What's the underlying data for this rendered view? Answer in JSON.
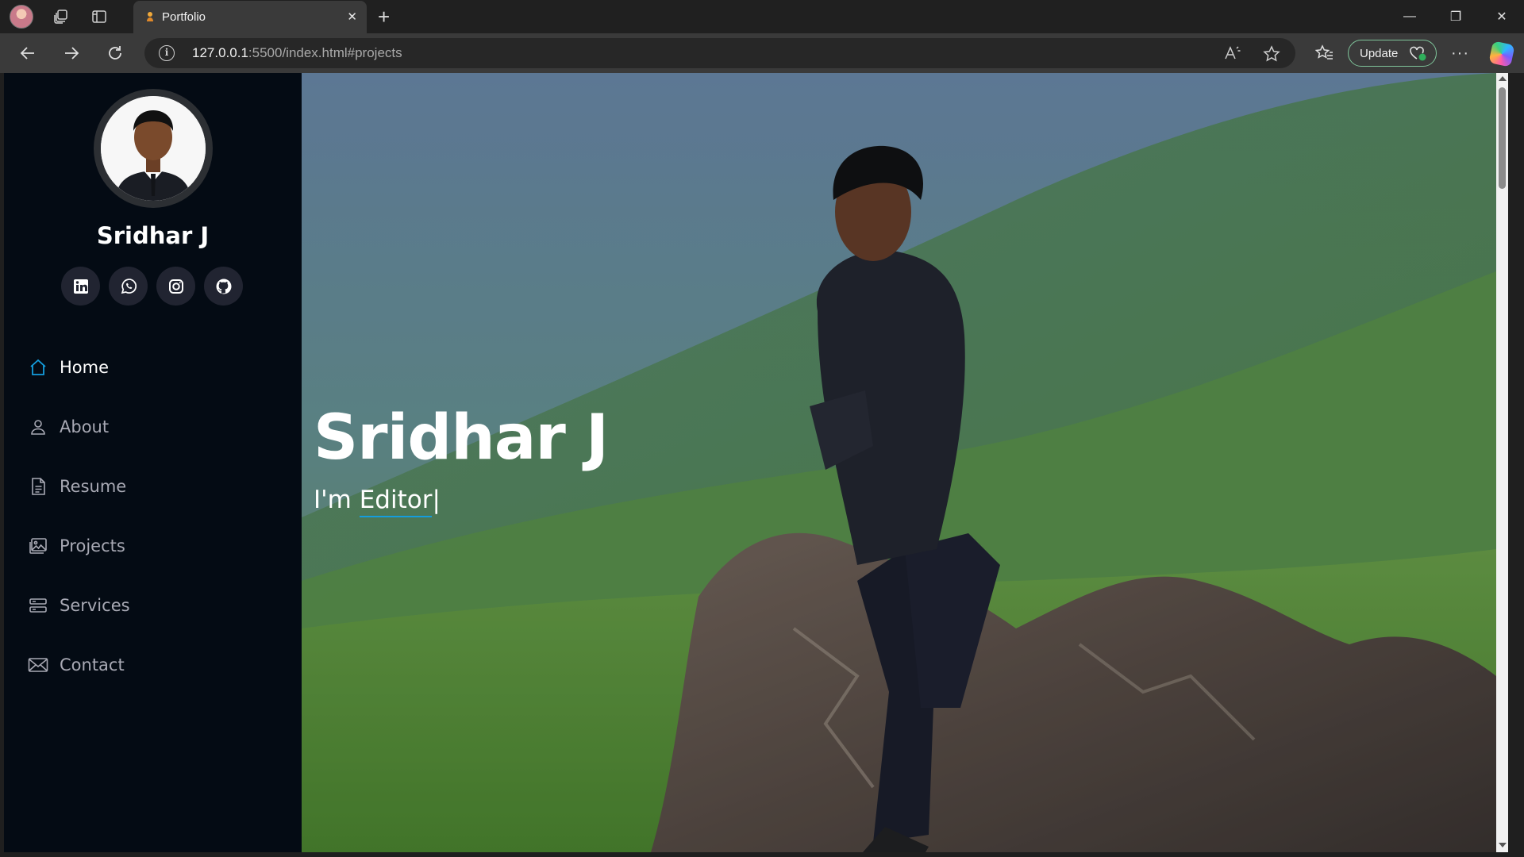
{
  "browser": {
    "tab_title": "Portfolio",
    "tab_close": "✕",
    "new_tab": "+",
    "url_host": "127.0.0.1",
    "url_rest": ":5500/index.html#projects",
    "update_label": "Update",
    "more": "···",
    "window_controls": {
      "minimize": "—",
      "restore": "❐",
      "close": "✕"
    }
  },
  "sidebar": {
    "name": "Sridhar J",
    "socials": [
      {
        "icon": "linkedin-icon"
      },
      {
        "icon": "whatsapp-icon"
      },
      {
        "icon": "instagram-icon"
      },
      {
        "icon": "github-icon"
      }
    ],
    "nav": [
      {
        "label": "Home",
        "icon": "home-icon",
        "active": true
      },
      {
        "label": "About",
        "icon": "person-icon"
      },
      {
        "label": "Resume",
        "icon": "file-icon"
      },
      {
        "label": "Projects",
        "icon": "images-icon"
      },
      {
        "label": "Services",
        "icon": "server-icon"
      },
      {
        "label": "Contact",
        "icon": "envelope-icon"
      }
    ]
  },
  "hero": {
    "name": "Sridhar J",
    "prefix": "I'm ",
    "role": "Editor",
    "cursor": "|"
  },
  "colors": {
    "accent": "#149ddd",
    "sidebar_bg": "#040b14"
  }
}
